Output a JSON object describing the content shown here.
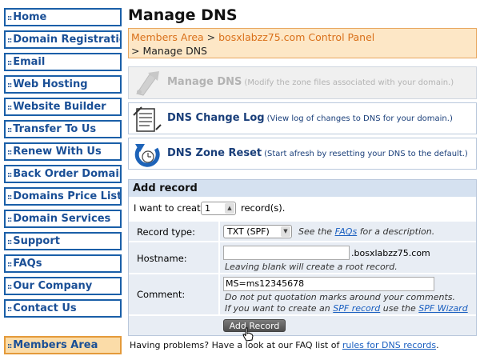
{
  "sidebar": {
    "prefix": "::",
    "items": [
      {
        "label": "Home"
      },
      {
        "label": "Domain Registration"
      },
      {
        "label": "Email"
      },
      {
        "label": "Web Hosting"
      },
      {
        "label": "Website Builder"
      },
      {
        "label": "Transfer To Us"
      },
      {
        "label": "Renew With Us"
      },
      {
        "label": "Back Order Domains"
      },
      {
        "label": "Domains Price List"
      },
      {
        "label": "Domain Services"
      },
      {
        "label": "Support"
      },
      {
        "label": "FAQs"
      },
      {
        "label": "Our Company"
      },
      {
        "label": "Contact Us"
      }
    ],
    "members": {
      "label": "Members Area"
    }
  },
  "main": {
    "title": "Manage DNS",
    "breadcrumb": {
      "link1": "Members Area",
      "sep": ">",
      "link2": "bosxlabzz75.com Control Panel",
      "current": "> Manage DNS"
    },
    "tools": [
      {
        "name": "Manage DNS",
        "desc": "(Modify the zone files associated with your domain.)"
      },
      {
        "name": "DNS Change Log",
        "desc": "(View log of changes to DNS for your domain.)"
      },
      {
        "name": "DNS Zone Reset",
        "desc": "(Start afresh by resetting your DNS to the default.)"
      }
    ],
    "add_record": {
      "header": "Add record",
      "create_prefix": "I want to create",
      "count_value": "1",
      "create_suffix": "record(s).",
      "record_type_label": "Record type:",
      "record_type_value": "TXT (SPF)",
      "record_type_hint_pre": "See the",
      "record_type_hint_link": "FAQs",
      "record_type_hint_post": "for a description.",
      "hostname_label": "Hostname:",
      "hostname_value": "",
      "hostname_suffix": ".bosxlabzz75.com",
      "hostname_hint": "Leaving blank will create a root record.",
      "comment_label": "Comment:",
      "comment_value": "MS=ms12345678",
      "comment_hint1": "Do not put quotation marks around your comments.",
      "comment_hint2_pre": "If you want to create an",
      "comment_hint2_link1": "SPF record",
      "comment_hint2_mid": "use the",
      "comment_hint2_link2": "SPF Wizard",
      "button_label": "Add Record"
    },
    "problems_text": "Having problems? Have a look at our FAQ list of",
    "problems_link": "rules for DNS records",
    "problems_end": "."
  },
  "colors": {
    "nav_border": "#1a5fa8",
    "nav_text": "#1a4f96",
    "members_bg": "#fbdca8",
    "breadcrumb_bg": "#fde7c6",
    "breadcrumb_link": "#d9701a",
    "table_header_bg": "#d5e1f0"
  },
  "icons": [
    "document-icon",
    "change-log-icon",
    "reset-arrow-icon",
    "select-arrow-icon",
    "hand-cursor-icon"
  ]
}
